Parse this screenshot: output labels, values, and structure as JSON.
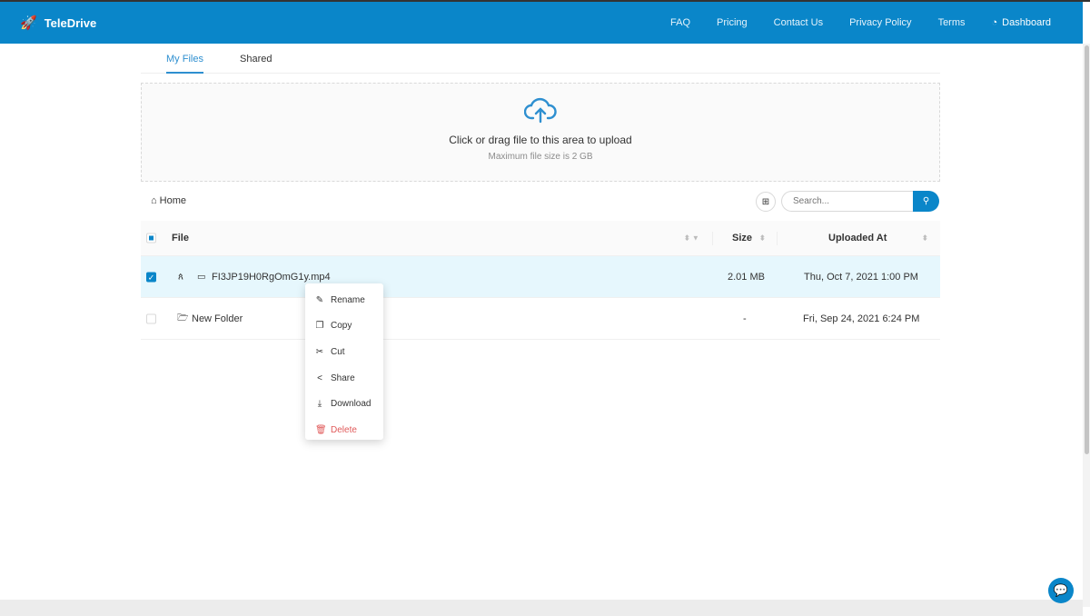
{
  "header": {
    "brand": "TeleDrive",
    "nav": [
      "FAQ",
      "Pricing",
      "Contact Us",
      "Privacy Policy",
      "Terms"
    ],
    "dashboard": "Dashboard"
  },
  "tabs": {
    "my_files": "My Files",
    "shared": "Shared"
  },
  "upload": {
    "title": "Click or drag file to this area to upload",
    "hint": "Maximum file size is 2 GB"
  },
  "breadcrumb": {
    "home": "Home"
  },
  "search": {
    "placeholder": "Search..."
  },
  "table": {
    "headers": {
      "file": "File",
      "size": "Size",
      "uploaded": "Uploaded At"
    },
    "rows": [
      {
        "name": "FI3JP19H0RgOmG1y.mp4",
        "size": "2.01 MB",
        "uploaded": "Thu, Oct 7, 2021 1:00 PM",
        "selected": true
      },
      {
        "name": "New Folder",
        "size": "-",
        "uploaded": "Fri, Sep 24, 2021 6:24 PM",
        "selected": false
      }
    ]
  },
  "context_menu": {
    "rename": "Rename",
    "copy": "Copy",
    "cut": "Cut",
    "share": "Share",
    "download": "Download",
    "delete": "Delete"
  },
  "colors": {
    "primary": "#0a86c9",
    "danger": "#e05a5a",
    "selected_row": "#e6f7fd"
  }
}
